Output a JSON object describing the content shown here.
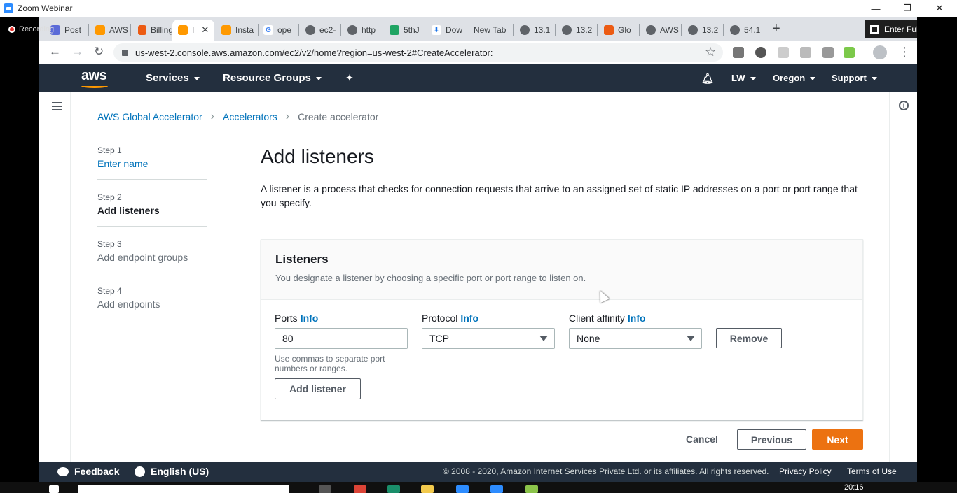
{
  "zoom": {
    "title": "Zoom Webinar",
    "recording": "Recording",
    "min": "—",
    "max": "❐",
    "close": "✕"
  },
  "browser": {
    "tabs": [
      {
        "label": "Post",
        "color": "#5b6bd8"
      },
      {
        "label": "AWS",
        "color": "#ff9900"
      },
      {
        "label": "Billing",
        "color": "#ec5b13"
      },
      {
        "label": "I",
        "color": "#ff9900"
      },
      {
        "label": "Insta",
        "color": "#ff9900"
      },
      {
        "label": "ope",
        "color": "#4285f4"
      },
      {
        "label": "ec2-",
        "color": "#5f6368"
      },
      {
        "label": "http",
        "color": "#5f6368"
      },
      {
        "label": "5thJ",
        "color": "#1fa463"
      },
      {
        "label": "Dow",
        "color": "#1a73e8"
      },
      {
        "label": "New Tab",
        "color": ""
      },
      {
        "label": "13.1",
        "color": "#5f6368"
      },
      {
        "label": "13.2",
        "color": "#5f6368"
      },
      {
        "label": "Glo",
        "color": "#ec5b13"
      },
      {
        "label": "AWS",
        "color": "#5f6368"
      },
      {
        "label": "13.2",
        "color": "#5f6368"
      },
      {
        "label": "54.1",
        "color": "#5f6368"
      }
    ],
    "new_tab": "+",
    "fullscreen_label": "Enter Full Screen",
    "url": "us-west-2.console.aws.amazon.com/ec2/v2/home?region=us-west-2#CreateAccelerator:",
    "back": "←",
    "forward": "→",
    "reload": "↻",
    "star": "☆",
    "menu": "⋮"
  },
  "aws_nav": {
    "logo": "aws",
    "services": "Services",
    "resource_groups": "Resource Groups",
    "pin": "✦",
    "bell": "🔔",
    "user": "LW",
    "region": "Oregon",
    "support": "Support"
  },
  "breadcrumb": {
    "root": "AWS Global Accelerator",
    "section": "Accelerators",
    "current": "Create accelerator",
    "sep": "›"
  },
  "steps": [
    {
      "num": "Step 1",
      "title": "Enter name"
    },
    {
      "num": "Step 2",
      "title": "Add listeners"
    },
    {
      "num": "Step 3",
      "title": "Add endpoint groups"
    },
    {
      "num": "Step 4",
      "title": "Add endpoints"
    }
  ],
  "main": {
    "title": "Add listeners",
    "description": "A listener is a process that checks for connection requests that arrive to an assigned set of static IP addresses on a port or port range that you specify."
  },
  "listeners": {
    "title": "Listeners",
    "description": "You designate a listener by choosing a specific port or port range to listen on.",
    "info": "Info",
    "ports_label": "Ports",
    "ports_value": "80",
    "ports_hint": "Use commas to separate port numbers or ranges.",
    "protocol_label": "Protocol",
    "protocol_value": "TCP",
    "affinity_label": "Client affinity",
    "affinity_value": "None",
    "remove": "Remove",
    "add_listener": "Add listener"
  },
  "actions": {
    "cancel": "Cancel",
    "previous": "Previous",
    "next": "Next"
  },
  "footer": {
    "feedback": "Feedback",
    "language": "English (US)",
    "copyright": "© 2008 - 2020, Amazon Internet Services Private Ltd. or its affiliates. All rights reserved.",
    "privacy": "Privacy Policy",
    "terms": "Terms of Use"
  },
  "taskbar": {
    "time": "20:16"
  },
  "colors": {
    "aws_nav": "#232f3e",
    "link": "#0073bb",
    "primary": "#ec7211"
  }
}
